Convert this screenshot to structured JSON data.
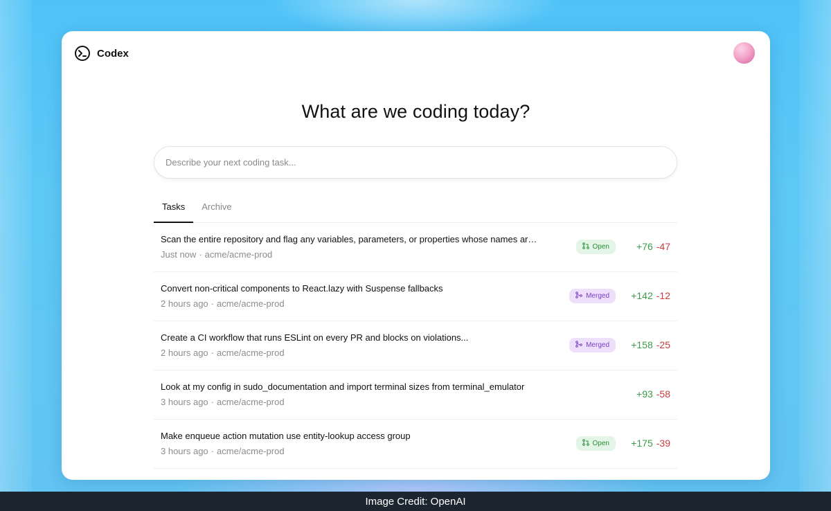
{
  "app": {
    "name": "Codex"
  },
  "hero": {
    "title": "What are we coding today?"
  },
  "input": {
    "placeholder": "Describe your next coding task..."
  },
  "tabs": [
    {
      "label": "Tasks",
      "active": true
    },
    {
      "label": "Archive",
      "active": false
    }
  ],
  "tasks": [
    {
      "title": "Scan the entire repository and flag any variables, parameters, or properties whose names are v...",
      "time": "Just now",
      "repo": "acme/acme-prod",
      "status": "Open",
      "additions": "+76",
      "deletions": "-47"
    },
    {
      "title": "Convert non-critical components to React.lazy with Suspense fallbacks",
      "time": "2 hours ago",
      "repo": "acme/acme-prod",
      "status": "Merged",
      "additions": "+142",
      "deletions": "-12"
    },
    {
      "title": "Create a CI workflow that runs ESLint on every PR and blocks on violations...",
      "time": "2 hours ago",
      "repo": "acme/acme-prod",
      "status": "Merged",
      "additions": "+158",
      "deletions": "-25"
    },
    {
      "title": "Look at my config in sudo_documentation and import terminal sizes from terminal_emulator",
      "time": "3 hours ago",
      "repo": "acme/acme-prod",
      "status": "",
      "additions": "+93",
      "deletions": "-58"
    },
    {
      "title": "Make enqueue action mutation use entity-lookup access group",
      "time": "3 hours ago",
      "repo": "acme/acme-prod",
      "status": "Open",
      "additions": "+175",
      "deletions": "-39"
    }
  ],
  "meta_separator": "·",
  "footer": {
    "credit": "Image Credit: OpenAI"
  },
  "colors": {
    "open_badge": "#e3f5e6",
    "merged_badge": "#eee0fa",
    "additions": "#3c9a4a",
    "deletions": "#cc3a3a"
  }
}
